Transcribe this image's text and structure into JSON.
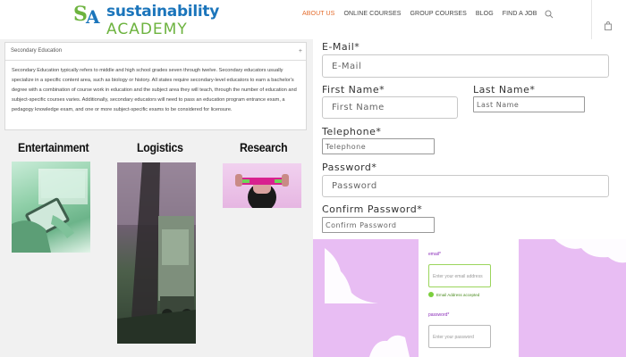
{
  "header": {
    "logo_line1": "sustainability",
    "logo_line2": "ACADEMY",
    "nav": [
      "ABOUT US",
      "ONLINE COURSES",
      "GROUP COURSES",
      "BLOG",
      "FIND A JOB"
    ]
  },
  "accordion": {
    "title": "Secondary Education",
    "toggle": "+",
    "body": "Secondary Education typically refers to middle and high school grades seven through twelve. Secondary educators usually specialize in a specific content area, such as biology or history. All states require secondary-level educators to earn a bachelor's degree with a combination of course work in education and the subject area they will teach, through the number of education and subject-specific courses varies. Additionally, secondary educators will need to pass an education program entrance exam, a pedagogy knowledge exam, and one or more subject-specific exams to be considered for licensure."
  },
  "categories": [
    "Entertainment",
    "Logistics",
    "Research"
  ],
  "form": {
    "email_label": "E-Mail*",
    "email_placeholder": "E-Mail",
    "first_name_label": "First Name*",
    "first_name_placeholder": "First Name",
    "last_name_label": "Last Name*",
    "last_name_placeholder": "Last Name",
    "telephone_label": "Telephone*",
    "telephone_placeholder": "Telephone",
    "password_label": "Password*",
    "password_placeholder": "Password",
    "confirm_label": "Confirm Password*",
    "confirm_placeholder": "Confirm Password"
  },
  "mini_form": {
    "email_label": "email*",
    "email_placeholder": "Enter your email address",
    "ok_text": "Email Address accepted",
    "password_label": "password*",
    "password_placeholder": "Enter your password"
  },
  "colors": {
    "accent": "#e46b2b",
    "brand_blue": "#1b75bb",
    "brand_green": "#6db33f",
    "pink": "#e8bdf3"
  }
}
